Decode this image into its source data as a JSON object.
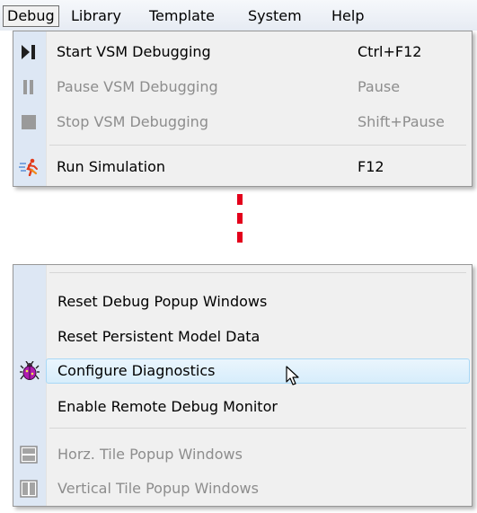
{
  "menubar": {
    "items": [
      {
        "label": "Debug",
        "active": true
      },
      {
        "label": "Library"
      },
      {
        "label": "Template"
      },
      {
        "label": "System"
      },
      {
        "label": "Help"
      }
    ]
  },
  "debug_menu": {
    "items": [
      {
        "label": "Start VSM Debugging",
        "shortcut": "Ctrl+F12",
        "icon": "play-step-icon",
        "enabled": true
      },
      {
        "label": "Pause VSM Debugging",
        "shortcut": "Pause",
        "icon": "pause-icon",
        "enabled": false
      },
      {
        "label": "Stop VSM Debugging",
        "shortcut": "Shift+Pause",
        "icon": "stop-icon",
        "enabled": false
      },
      {
        "label": "Run Simulation",
        "shortcut": "F12",
        "icon": "run-figure-icon",
        "enabled": true
      }
    ]
  },
  "debug_menu_lower": {
    "items": [
      {
        "label": "Reset Debug Popup Windows",
        "enabled": true
      },
      {
        "label": "Reset Persistent Model Data",
        "enabled": true
      },
      {
        "label": "Configure Diagnostics",
        "icon": "bug-icon",
        "enabled": true,
        "hovered": true
      },
      {
        "label": "Enable Remote Debug Monitor",
        "enabled": true
      },
      {
        "label": "Horz. Tile Popup Windows",
        "icon": "horizontal-tile-icon",
        "enabled": false
      },
      {
        "label": "Vertical Tile Popup Windows",
        "icon": "vertical-tile-icon",
        "enabled": false
      }
    ]
  },
  "colors": {
    "connector": "#e3001b",
    "gutter": "#dde7f4",
    "hover_border": "#a8d8f6",
    "disabled_text": "#8d8d8d"
  }
}
